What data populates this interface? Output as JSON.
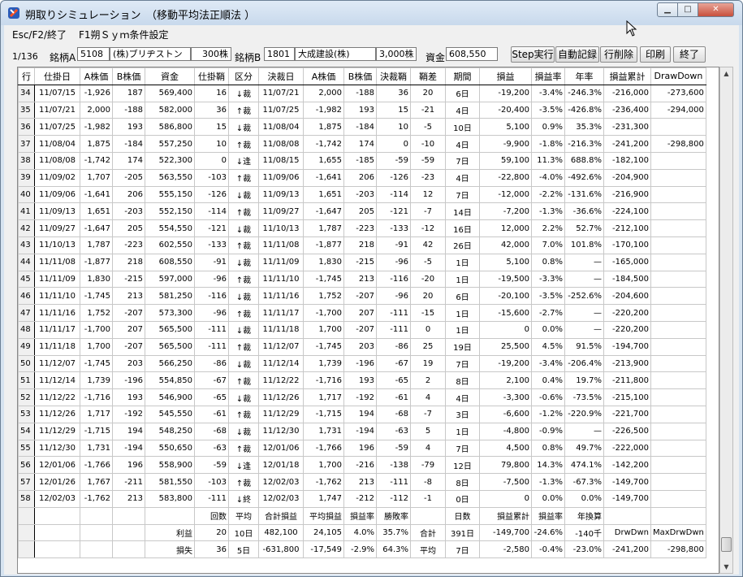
{
  "window": {
    "title": "朔取りシミュレーション　（移動平均法正順法 ）"
  },
  "menu": [
    "Esc/F2/終了",
    "F1朔Ｓｙｍ条件設定"
  ],
  "toolbar": {
    "counter": "1/136",
    "labelA": "銘柄A",
    "codeA": "5108",
    "nameA": "(株)ブリヂストン",
    "sharesA": "300株",
    "labelB": "銘柄B",
    "codeB": "1801",
    "nameB": "大成建設(株)",
    "sharesB": "3,000株",
    "capital_label": "資金",
    "capital": "608,550",
    "buttons": [
      "Step実行",
      "自動記録",
      "行削除",
      "印刷",
      "終了"
    ]
  },
  "columns": [
    "行",
    "仕掛日",
    "A株価",
    "B株価",
    "資金",
    "仕掛鞘",
    "区分",
    "決裁日",
    "A株価",
    "B株価",
    "決裁鞘",
    "鞘差",
    "期間",
    "損益",
    "損益率",
    "年率",
    "損益累計",
    "DrawDown"
  ],
  "rows": [
    [
      "34",
      "11/07/15",
      "-1,926",
      "187",
      "569,400",
      "16",
      "↓裁",
      "11/07/21",
      "2,000",
      "-188",
      "36",
      "20",
      "6日",
      "-19,200",
      "-3.4%",
      "-246.3%",
      "-216,000",
      "-273,600"
    ],
    [
      "35",
      "11/07/21",
      "2,000",
      "-188",
      "582,000",
      "36",
      "↑裁",
      "11/07/25",
      "-1,982",
      "193",
      "15",
      "-21",
      "4日",
      "-20,400",
      "-3.5%",
      "-426.8%",
      "-236,400",
      "-294,000"
    ],
    [
      "36",
      "11/07/25",
      "-1,982",
      "193",
      "586,800",
      "15",
      "↓裁",
      "11/08/04",
      "1,875",
      "-184",
      "10",
      "-5",
      "10日",
      "5,100",
      "0.9%",
      "35.3%",
      "-231,300",
      ""
    ],
    [
      "37",
      "11/08/04",
      "1,875",
      "-184",
      "557,250",
      "10",
      "↑裁",
      "11/08/08",
      "-1,742",
      "174",
      "0",
      "-10",
      "4日",
      "-9,900",
      "-1.8%",
      "-216.3%",
      "-241,200",
      "-298,800"
    ],
    [
      "38",
      "11/08/08",
      "-1,742",
      "174",
      "522,300",
      "0",
      "↓逢",
      "11/08/15",
      "1,655",
      "-185",
      "-59",
      "-59",
      "7日",
      "59,100",
      "11.3%",
      "688.8%",
      "-182,100",
      ""
    ],
    [
      "39",
      "11/09/02",
      "1,707",
      "-205",
      "563,550",
      "-103",
      "↑裁",
      "11/09/06",
      "-1,641",
      "206",
      "-126",
      "-23",
      "4日",
      "-22,800",
      "-4.0%",
      "-492.6%",
      "-204,900",
      ""
    ],
    [
      "40",
      "11/09/06",
      "-1,641",
      "206",
      "555,150",
      "-126",
      "↓裁",
      "11/09/13",
      "1,651",
      "-203",
      "-114",
      "12",
      "7日",
      "-12,000",
      "-2.2%",
      "-131.6%",
      "-216,900",
      ""
    ],
    [
      "41",
      "11/09/13",
      "1,651",
      "-203",
      "552,150",
      "-114",
      "↑裁",
      "11/09/27",
      "-1,647",
      "205",
      "-121",
      "-7",
      "14日",
      "-7,200",
      "-1.3%",
      "-36.6%",
      "-224,100",
      ""
    ],
    [
      "42",
      "11/09/27",
      "-1,647",
      "205",
      "554,550",
      "-121",
      "↓裁",
      "11/10/13",
      "1,787",
      "-223",
      "-133",
      "-12",
      "16日",
      "12,000",
      "2.2%",
      "52.7%",
      "-212,100",
      ""
    ],
    [
      "43",
      "11/10/13",
      "1,787",
      "-223",
      "602,550",
      "-133",
      "↑裁",
      "11/11/08",
      "-1,877",
      "218",
      "-91",
      "42",
      "26日",
      "42,000",
      "7.0%",
      "101.8%",
      "-170,100",
      ""
    ],
    [
      "44",
      "11/11/08",
      "-1,877",
      "218",
      "608,550",
      "-91",
      "↓裁",
      "11/11/09",
      "1,830",
      "-215",
      "-96",
      "-5",
      "1日",
      "5,100",
      "0.8%",
      "—",
      "-165,000",
      ""
    ],
    [
      "45",
      "11/11/09",
      "1,830",
      "-215",
      "597,000",
      "-96",
      "↑裁",
      "11/11/10",
      "-1,745",
      "213",
      "-116",
      "-20",
      "1日",
      "-19,500",
      "-3.3%",
      "—",
      "-184,500",
      ""
    ],
    [
      "46",
      "11/11/10",
      "-1,745",
      "213",
      "581,250",
      "-116",
      "↓裁",
      "11/11/16",
      "1,752",
      "-207",
      "-96",
      "20",
      "6日",
      "-20,100",
      "-3.5%",
      "-252.6%",
      "-204,600",
      ""
    ],
    [
      "47",
      "11/11/16",
      "1,752",
      "-207",
      "573,300",
      "-96",
      "↑裁",
      "11/11/17",
      "-1,700",
      "207",
      "-111",
      "-15",
      "1日",
      "-15,600",
      "-2.7%",
      "—",
      "-220,200",
      ""
    ],
    [
      "48",
      "11/11/17",
      "-1,700",
      "207",
      "565,500",
      "-111",
      "↓裁",
      "11/11/18",
      "1,700",
      "-207",
      "-111",
      "0",
      "1日",
      "0",
      "0.0%",
      "—",
      "-220,200",
      ""
    ],
    [
      "49",
      "11/11/18",
      "1,700",
      "-207",
      "565,500",
      "-111",
      "↑裁",
      "11/12/07",
      "-1,745",
      "203",
      "-86",
      "25",
      "19日",
      "25,500",
      "4.5%",
      "91.5%",
      "-194,700",
      ""
    ],
    [
      "50",
      "11/12/07",
      "-1,745",
      "203",
      "566,250",
      "-86",
      "↓裁",
      "11/12/14",
      "1,739",
      "-196",
      "-67",
      "19",
      "7日",
      "-19,200",
      "-3.4%",
      "-206.4%",
      "-213,900",
      ""
    ],
    [
      "51",
      "11/12/14",
      "1,739",
      "-196",
      "554,850",
      "-67",
      "↑裁",
      "11/12/22",
      "-1,716",
      "193",
      "-65",
      "2",
      "8日",
      "2,100",
      "0.4%",
      "19.7%",
      "-211,800",
      ""
    ],
    [
      "52",
      "11/12/22",
      "-1,716",
      "193",
      "546,900",
      "-65",
      "↓裁",
      "11/12/26",
      "1,717",
      "-192",
      "-61",
      "4",
      "4日",
      "-3,300",
      "-0.6%",
      "-73.5%",
      "-215,100",
      ""
    ],
    [
      "53",
      "11/12/26",
      "1,717",
      "-192",
      "545,550",
      "-61",
      "↑裁",
      "11/12/29",
      "-1,715",
      "194",
      "-68",
      "-7",
      "3日",
      "-6,600",
      "-1.2%",
      "-220.9%",
      "-221,700",
      ""
    ],
    [
      "54",
      "11/12/29",
      "-1,715",
      "194",
      "548,250",
      "-68",
      "↓裁",
      "11/12/30",
      "1,731",
      "-194",
      "-63",
      "5",
      "1日",
      "-4,800",
      "-0.9%",
      "—",
      "-226,500",
      ""
    ],
    [
      "55",
      "11/12/30",
      "1,731",
      "-194",
      "550,650",
      "-63",
      "↑裁",
      "12/01/06",
      "-1,766",
      "196",
      "-59",
      "4",
      "7日",
      "4,500",
      "0.8%",
      "49.7%",
      "-222,000",
      ""
    ],
    [
      "56",
      "12/01/06",
      "-1,766",
      "196",
      "558,900",
      "-59",
      "↓逢",
      "12/01/18",
      "1,700",
      "-216",
      "-138",
      "-79",
      "12日",
      "79,800",
      "14.3%",
      "474.1%",
      "-142,200",
      ""
    ],
    [
      "57",
      "12/01/26",
      "1,767",
      "-211",
      "581,550",
      "-103",
      "↑裁",
      "12/02/03",
      "-1,762",
      "213",
      "-111",
      "-8",
      "8日",
      "-7,500",
      "-1.3%",
      "-67.3%",
      "-149,700",
      ""
    ],
    [
      "58",
      "12/02/03",
      "-1,762",
      "213",
      "583,800",
      "-111",
      "↓終",
      "12/02/03",
      "1,747",
      "-212",
      "-112",
      "-1",
      "0日",
      "0",
      "0.0%",
      "0.0%",
      "-149,700",
      ""
    ]
  ],
  "summary": [
    [
      "",
      "",
      "",
      "",
      "",
      "回数",
      "平均",
      "合計損益",
      "平均損益",
      "損益率",
      "勝敗率",
      "",
      "日数",
      "損益累計",
      "損益率",
      "年換算",
      "",
      ""
    ],
    [
      "",
      "",
      "",
      "",
      "利益",
      "20",
      "10日",
      "482,100",
      "24,105",
      "4.0%",
      "35.7%",
      "合計",
      "391日",
      "-149,700",
      "-24.6%",
      "-140千",
      "DrwDwn",
      "MaxDrwDwn"
    ],
    [
      "",
      "",
      "",
      "",
      "損失",
      "36",
      "5日",
      "-631,800",
      "-17,549",
      "-2.9%",
      "64.3%",
      "平均",
      "7日",
      "-2,580",
      "-0.4%",
      "-23.0%",
      "-241,200",
      "-298,800"
    ]
  ]
}
